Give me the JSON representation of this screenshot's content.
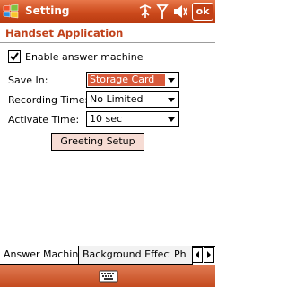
{
  "window": {
    "title": "Setting"
  },
  "toolbar": {
    "ok_label": "ok"
  },
  "header": {
    "title": "Handset Application"
  },
  "form": {
    "enable_label": "Enable answer machine",
    "enable_checked": true,
    "save_in": {
      "label": "Save In:",
      "value": "Storage Card"
    },
    "recording_time": {
      "label": "Recording Time:",
      "value": "No Limited"
    },
    "activate_time": {
      "label": "Activate Time:",
      "value": "10 sec"
    },
    "greeting_button": "Greeting Setup"
  },
  "tabs": [
    {
      "label": "Answer Machine",
      "active": true
    },
    {
      "label": "Background Effects",
      "active": false
    },
    {
      "label": "Ph",
      "active": false
    }
  ],
  "colors": {
    "accent": "#cc4a1c",
    "header_text": "#c0411a",
    "selection": "#d8593a"
  },
  "icons": [
    "windows-start-icon",
    "connectivity-icon",
    "signal-icon",
    "speaker-icon",
    "keyboard-icon"
  ]
}
